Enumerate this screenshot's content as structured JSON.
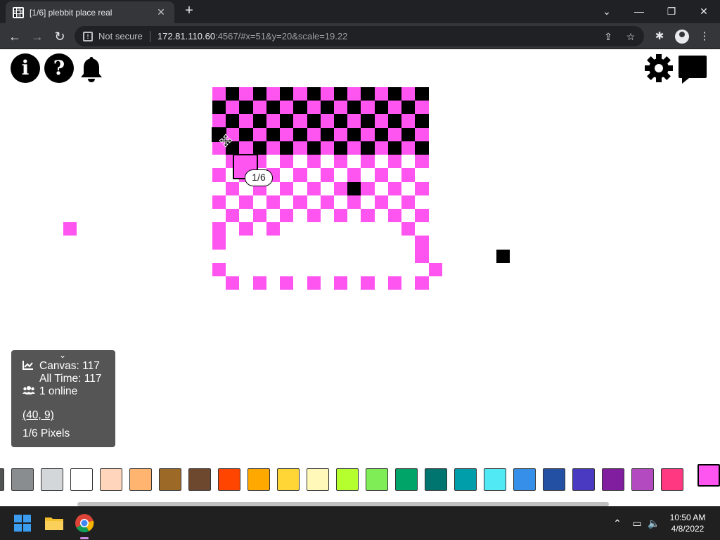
{
  "browser": {
    "tab_title": "[1/6] plebbit place real",
    "tab_close": "✕",
    "new_tab": "+",
    "security_label": "Not secure",
    "url_host": "172.81.110.60",
    "url_rest": ":4567/#x=51&y=20&scale=19.22",
    "window": {
      "minimize": "—",
      "maximize": "❐",
      "close": "✕",
      "tabsearch": "⌄"
    },
    "nav": {
      "back": "←",
      "forward": "→",
      "reload": "↻"
    }
  },
  "page": {
    "info_button": "i",
    "help_button": "?",
    "tooltip": "1/6",
    "stats": {
      "canvas_label": "Canvas: 117",
      "alltime_label": "All Time: 117",
      "online_label": "1 online",
      "coords": "(40, 9)",
      "pixels": "1/6 Pixels"
    },
    "palette_colors": [
      "#515252",
      "#898d90",
      "#d4d7d9",
      "#ffffff",
      "#ffd6bb",
      "#ffb470",
      "#9c6926",
      "#6d482f",
      "#ff4500",
      "#ffa800",
      "#ffd635",
      "#fff8b8",
      "#b4ff2d",
      "#7eed56",
      "#00a368",
      "#00756f",
      "#009eaa",
      "#51e9f4",
      "#3690ea",
      "#2450a4",
      "#493ac1",
      "#811e9f",
      "#b44ac0",
      "#ff3881",
      "#ff99aa"
    ],
    "selected_color": "#ff55f0"
  },
  "taskbar": {
    "time": "10:50 AM",
    "date": "4/8/2022"
  }
}
